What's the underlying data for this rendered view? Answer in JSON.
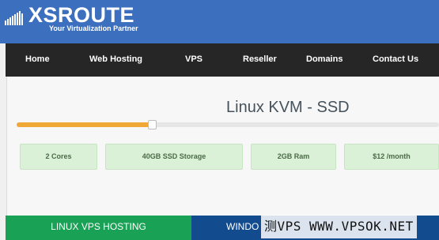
{
  "header": {
    "logo_text": "XSROUTE",
    "tagline": "Your Virtualization Partner",
    "logo_icon": "bar-chart-logo-icon"
  },
  "nav": {
    "items": [
      {
        "label": "Home"
      },
      {
        "label": "Web Hosting"
      },
      {
        "label": "VPS"
      },
      {
        "label": "Reseller"
      },
      {
        "label": "Domains"
      },
      {
        "label": "Contact Us"
      }
    ]
  },
  "plan": {
    "title": "Linux KVM - SSD",
    "slider_level_fraction": 0.32,
    "slider_color": "#f0a836"
  },
  "features": [
    {
      "label": "2 Cores"
    },
    {
      "label": "40GB SSD Storage"
    },
    {
      "label": "2GB Ram"
    },
    {
      "label": "$12 /month"
    }
  ],
  "tabs": {
    "linux": "LINUX VPS HOSTING",
    "windows": "WINDO"
  },
  "watermark": "测VPS WWW.VPSOK.NET",
  "colors": {
    "header_bg": "#3d6fbf",
    "nav_bg": "#262626",
    "feature_bg": "#daf0d7",
    "linux_tab": "#19a155",
    "windows_tab": "#124b8e"
  }
}
